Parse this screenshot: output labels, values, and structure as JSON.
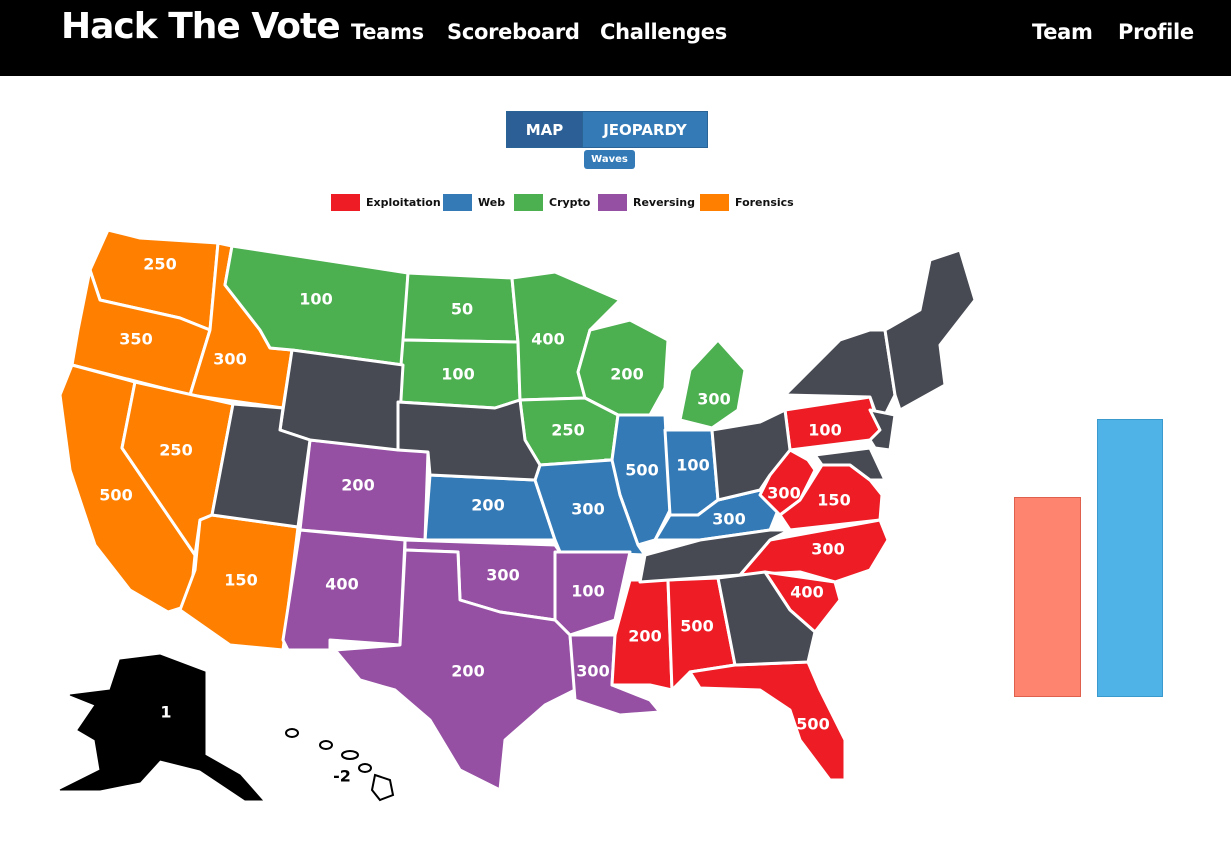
{
  "navbar": {
    "brand": "Hack The Vote",
    "links": [
      "Teams",
      "Scoreboard",
      "Challenges"
    ],
    "right_links": [
      "Team",
      "Profile"
    ]
  },
  "view_toggle": {
    "map_label": "MAP",
    "jeopardy_label": "JEOPARDY",
    "active": "MAP"
  },
  "waves_badge": "Waves",
  "legend": [
    {
      "label": "Exploitation",
      "color": "#ee1c25"
    },
    {
      "label": "Web",
      "color": "#337ab7"
    },
    {
      "label": "Crypto",
      "color": "#4caf50"
    },
    {
      "label": "Reversing",
      "color": "#954fa3"
    },
    {
      "label": "Forensics",
      "color": "#ff7f00"
    }
  ],
  "colors": {
    "solved": "#474a53",
    "alaska": "#000000",
    "bar_left": "#ff8470",
    "bar_right": "#4fb3e8"
  },
  "states": {
    "WA": "250",
    "OR": "350",
    "ID": "300",
    "CA": "500",
    "NV": "250",
    "AZ": "150",
    "MT": "100",
    "ND": "50",
    "SD": "100",
    "MN": "400",
    "WI": "200",
    "MI": "300",
    "IA": "250",
    "IL": "500",
    "IN": "100",
    "MO": "300",
    "KS": "200",
    "KY": "300",
    "CO": "200",
    "NM": "400",
    "OK": "300",
    "AR": "100",
    "TX": "200",
    "LA": "300",
    "PA": "100",
    "WV": "300",
    "VA": "150",
    "NC": "300",
    "SC": "400",
    "MS": "200",
    "AL": "500",
    "FL": "500",
    "AK": "1",
    "HI": "-2"
  },
  "bars": {
    "left_value": 0.72,
    "right_value": 1.0
  }
}
